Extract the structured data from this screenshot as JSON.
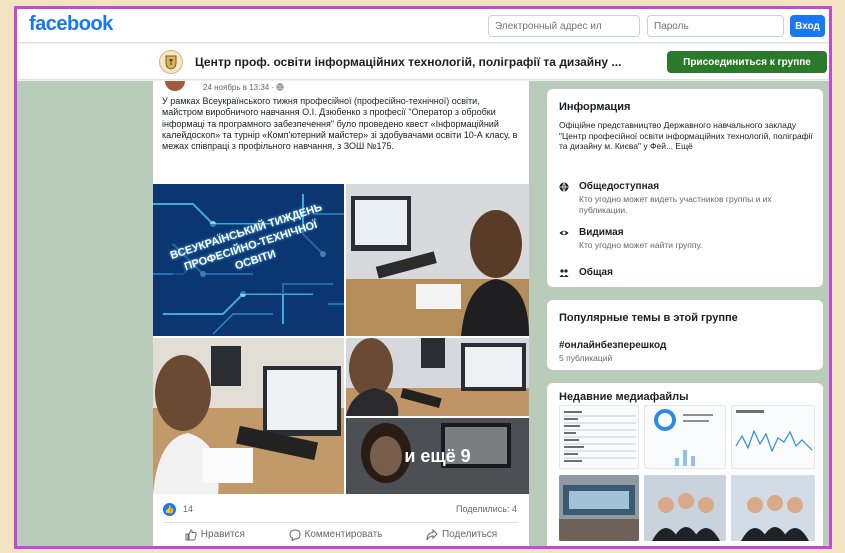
{
  "topbar": {
    "logo": "facebook",
    "email_placeholder": "Электронный адрес ил",
    "password_placeholder": "Пароль",
    "login_label": "Вход"
  },
  "group": {
    "name": "Центр проф. освіти інформаційних технологій, поліграфії та дизайну ...",
    "join_label": "Присоединиться к группе"
  },
  "post": {
    "meta": "24 ноябрь в 13:34 · ",
    "text": "У рамках Всеукраїнського тижня професійної (професійно-технічної) освіти, майстром виробничого навчання О.І. Дзюбенко з професії \"Оператор з обробки інформаці та програмного забезпечення\" було проведено квест «Інформаційний калейдоскоп» та турнір «Комп'ютерний майстер» зі здобувачами освіти 10-А класу, в межах співпраці з профільного навчання, з ЗОШ №175.",
    "photo_banner": "ВСЕУКРАЇНСЬКИЙ ТИЖДЕНЬ ПРОФЕСІЙНО-ТЕХНІЧНОЇ ОСВІТИ",
    "more_photos": "и ещё 9",
    "likes": "14",
    "shares": "Поделились: 4",
    "actions": {
      "like": "Нравится",
      "comment": "Комментировать",
      "share": "Поделиться"
    }
  },
  "info": {
    "title": "Информация",
    "description": "Офіційне представництво Державного навчального закладу \"Центр професійної освіти інформаційних технологій, поліграфії та дизайну м. Києва\" у Фей... Ещё",
    "rows": [
      {
        "title": "Общедоступная",
        "sub": "Кто угодно может видеть участников группы и их публикации.",
        "icon": "globe-icon"
      },
      {
        "title": "Видимая",
        "sub": "Кто угодно может найти группу.",
        "icon": "eye-icon"
      },
      {
        "title": "Общая",
        "sub": "",
        "icon": "people-icon"
      }
    ]
  },
  "topics": {
    "title": "Популярные темы в этой группе",
    "tag": "#онлайнбезперешкод",
    "count": "5 публикаций"
  },
  "media": {
    "title": "Недавние медиафайлы"
  },
  "colors": {
    "brand": "#1877f2",
    "join": "#2b7a2b",
    "frame": "#c34ad9"
  }
}
